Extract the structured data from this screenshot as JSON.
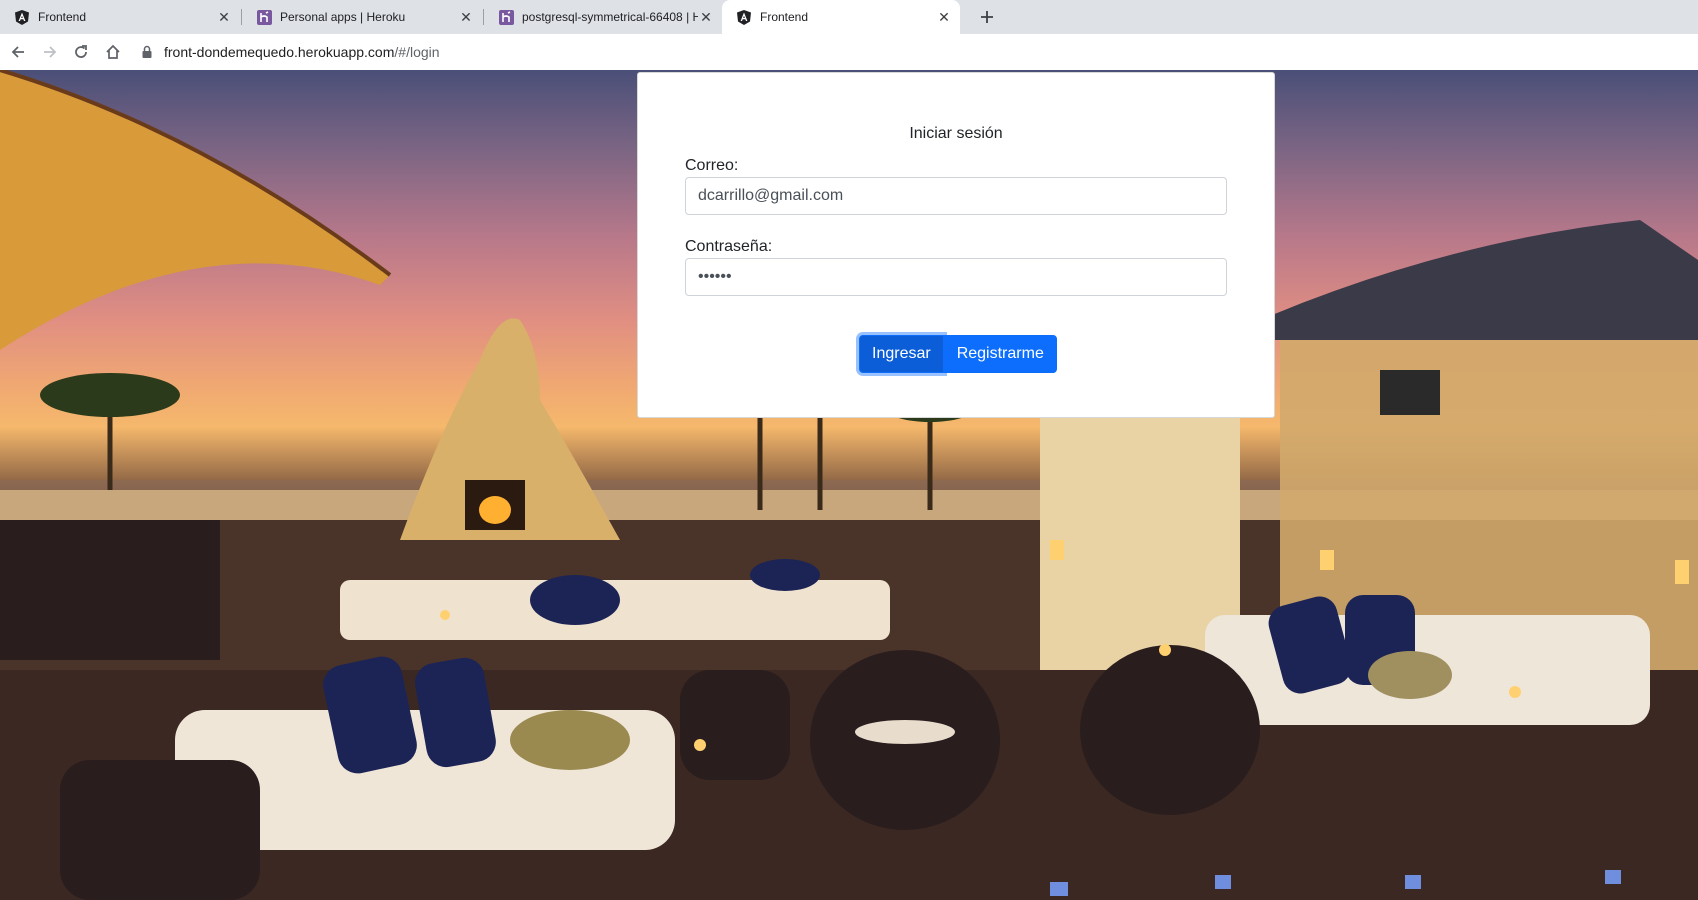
{
  "tabs": [
    {
      "title": "Frontend",
      "icon": "angular-icon",
      "active": false
    },
    {
      "title": "Personal apps | Heroku",
      "icon": "heroku-icon",
      "active": false
    },
    {
      "title": "postgresql-symmetrical-66408 | H",
      "icon": "heroku-icon",
      "active": false
    },
    {
      "title": "Frontend",
      "icon": "angular-icon",
      "active": true
    }
  ],
  "address_bar": {
    "domain": "front-dondemequedo.herokuapp.com",
    "path": "/#/login"
  },
  "login": {
    "title": "Iniciar sesión",
    "email_label": "Correo:",
    "email_value": "dcarrillo@gmail.com",
    "password_label": "Contraseña:",
    "password_value": "••••••",
    "login_button": "Ingresar",
    "register_button": "Registrarme"
  },
  "colors": {
    "primary": "#0d6efd",
    "tabstrip": "#dee1e6"
  }
}
